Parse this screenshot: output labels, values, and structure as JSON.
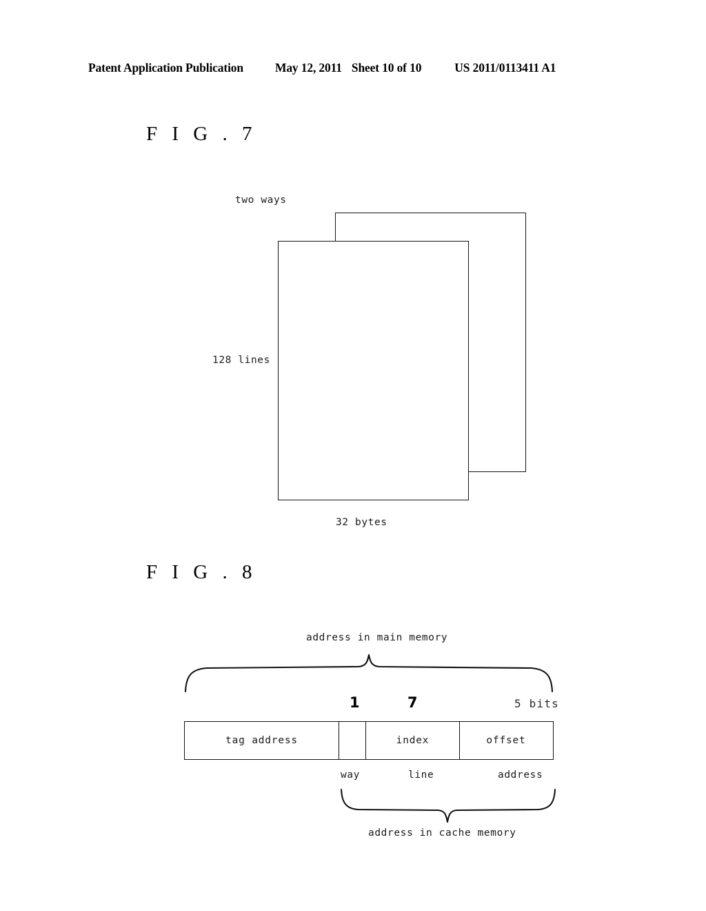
{
  "header": {
    "publication": "Patent Application Publication",
    "date": "May 12, 2011",
    "sheet": "Sheet 10 of 10",
    "document_number": "US 2011/0113411 A1"
  },
  "figures": [
    {
      "caption": "F I G .  7",
      "labels": {
        "ways": "two ways",
        "lines": "128 lines",
        "bytes": "32 bytes"
      }
    },
    {
      "caption": "F I G .  8",
      "labels": {
        "top_brace": "address in main memory",
        "bottom_brace": "address in cache memory"
      },
      "bit_counts": {
        "way": "1",
        "index": "7",
        "offset": "5 bits"
      },
      "fields": [
        {
          "name": "tag address"
        },
        {
          "name": ""
        },
        {
          "name": "index"
        },
        {
          "name": "offset"
        }
      ],
      "sub_labels": {
        "way": "way",
        "line": "line",
        "address": "address"
      }
    }
  ]
}
